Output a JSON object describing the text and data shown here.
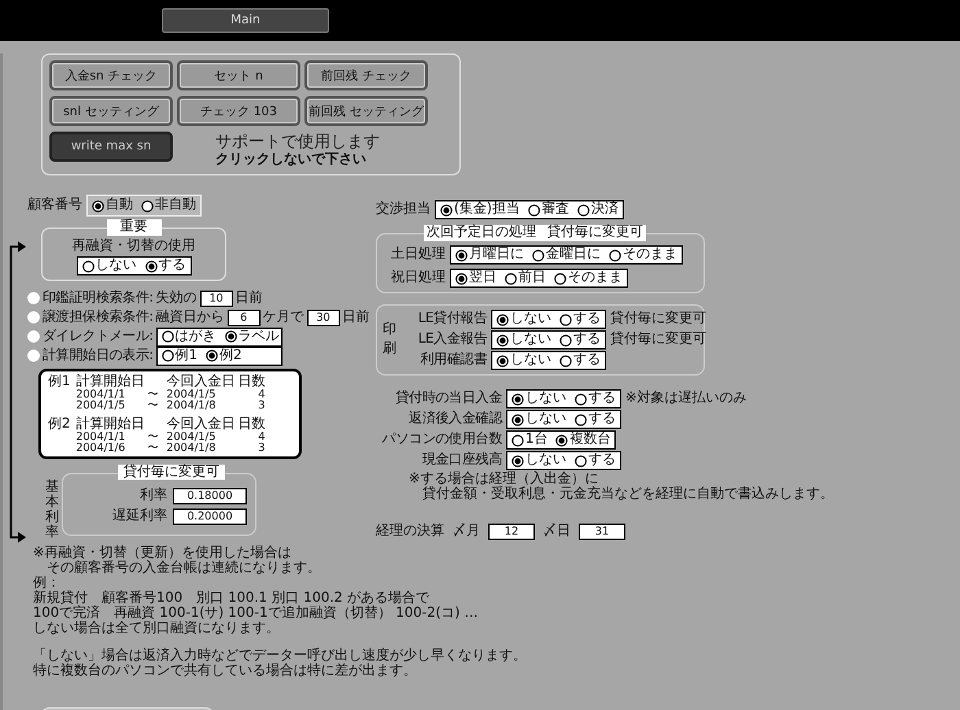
{
  "tab": {
    "label": "Main"
  },
  "tool_buttons": [
    {
      "label": "入金sn チェック",
      "kind": "normal"
    },
    {
      "label": "セット n",
      "kind": "normal"
    },
    {
      "label": "前回残 チェック",
      "kind": "normal"
    },
    {
      "label": "snl セッティング",
      "kind": "normal"
    },
    {
      "label": "チェック 103",
      "kind": "normal"
    },
    {
      "label": "前回残 セッティング",
      "kind": "normal"
    },
    {
      "label": "write max sn",
      "kind": "dark"
    }
  ],
  "support_note": {
    "title": "サポートで使用します",
    "subtitle": "クリックしないで下さい"
  },
  "customer_number": {
    "label": "顧客番号",
    "options": [
      {
        "label": "自動",
        "selected": true
      },
      {
        "label": "非自動",
        "selected": false
      }
    ]
  },
  "important": {
    "heading": "重要",
    "label": "再融資・切替の使用",
    "options": [
      {
        "label": "しない",
        "selected": false
      },
      {
        "label": "する",
        "selected": true
      }
    ]
  },
  "search_settings": [
    {
      "kind": "fields",
      "label": "印鑑証明検索条件:",
      "parts": [
        {
          "kind": "text",
          "text": "失効の"
        },
        {
          "kind": "field",
          "value": "10"
        },
        {
          "kind": "text",
          "text": "日前"
        }
      ]
    },
    {
      "kind": "fields",
      "label": "譲渡担保検索条件:",
      "parts": [
        {
          "kind": "text",
          "text": "融資日から"
        },
        {
          "kind": "field",
          "value": "6"
        },
        {
          "kind": "text",
          "text": "ケ月で"
        },
        {
          "kind": "field",
          "value": "30"
        },
        {
          "kind": "text",
          "text": "日前"
        }
      ]
    },
    {
      "kind": "radio",
      "label": "ダイレクトメール:",
      "options": [
        {
          "label": "はがき",
          "selected": false
        },
        {
          "label": "ラベル",
          "selected": true
        }
      ]
    },
    {
      "kind": "radio",
      "label": "計算開始日の表示:",
      "options": [
        {
          "label": "例1",
          "selected": false
        },
        {
          "label": "例2",
          "selected": true
        }
      ]
    }
  ],
  "examples": [
    {
      "label": "例1",
      "header": [
        "計算開始日",
        "今回入金日",
        "日数"
      ],
      "rows": [
        [
          "2004/1/1",
          "〜",
          "2004/1/5",
          "4"
        ],
        [
          "2004/1/5",
          "〜",
          "2004/1/8",
          "3"
        ]
      ]
    },
    {
      "label": "例2",
      "header": [
        "計算開始日",
        "今回入金日",
        "日数"
      ],
      "rows": [
        [
          "2004/1/1",
          "〜",
          "2004/1/5",
          "4"
        ],
        [
          "2004/1/6",
          "〜",
          "2004/1/8",
          "3"
        ]
      ]
    }
  ],
  "base_rate": {
    "heading": "貸付毎に変更可",
    "side_label": "基本利率",
    "fields": [
      {
        "label": "利率",
        "value": "0.18000"
      },
      {
        "label": "遅延利率",
        "value": "0.20000"
      }
    ]
  },
  "notes": [
    [
      "※再融資・切替（更新）を使用した場合は",
      "　その顧客番号の入金台帳は連続になります。",
      "例：",
      "新規貸付　顧客番号100　別口 100.1 別口 100.2 がある場合で",
      "100で完済　再融資 100-1(サ) 100-1で追加融資（切替） 100-2(コ) …",
      "しない場合は全て別口融資になります。"
    ],
    [
      "「しない」場合は返済入力時などでデーター呼び出し速度が少し早くなります。",
      "特に複数台のパソコンで共有している場合は特に差が出ます。"
    ]
  ],
  "negotiation": {
    "label": "交渉担当",
    "options": [
      {
        "label": "(集金)担当",
        "selected": true
      },
      {
        "label": "審査",
        "selected": false
      },
      {
        "label": "決済",
        "selected": false
      }
    ]
  },
  "next_date": {
    "heading": "次回予定日の処理",
    "heading_note": "貸付毎に変更可",
    "rows": [
      {
        "label": "土日処理",
        "options": [
          {
            "label": "月曜日に",
            "selected": true
          },
          {
            "label": "金曜日に",
            "selected": false
          },
          {
            "label": "そのまま",
            "selected": false
          }
        ]
      },
      {
        "label": "祝日処理",
        "options": [
          {
            "label": "翌日",
            "selected": true
          },
          {
            "label": "前日",
            "selected": false
          },
          {
            "label": "そのまま",
            "selected": false
          }
        ]
      }
    ]
  },
  "print": {
    "side_label": "印刷",
    "rows": [
      {
        "label": "LE貸付報告",
        "options": [
          {
            "label": "しない",
            "selected": true
          },
          {
            "label": "する",
            "selected": false
          }
        ],
        "note": "貸付毎に変更可"
      },
      {
        "label": "LE入金報告",
        "options": [
          {
            "label": "しない",
            "selected": true
          },
          {
            "label": "する",
            "selected": false
          }
        ],
        "note": "貸付毎に変更可"
      },
      {
        "label": "利用確認書",
        "options": [
          {
            "label": "しない",
            "selected": true
          },
          {
            "label": "する",
            "selected": false
          }
        ]
      }
    ]
  },
  "loan_settings": {
    "rows": [
      {
        "label": "貸付時の当日入金",
        "options": [
          {
            "label": "しない",
            "selected": true
          },
          {
            "label": "する",
            "selected": false
          }
        ],
        "note": "※対象は遅払いのみ"
      },
      {
        "label": "返済後入金確認",
        "options": [
          {
            "label": "しない",
            "selected": true
          },
          {
            "label": "する",
            "selected": false
          }
        ]
      },
      {
        "label": "パソコンの使用台数",
        "options": [
          {
            "label": "1台",
            "selected": false
          },
          {
            "label": "複数台",
            "selected": true
          }
        ]
      },
      {
        "label": "現金口座残高",
        "options": [
          {
            "label": "しない",
            "selected": true
          },
          {
            "label": "する",
            "selected": false
          }
        ]
      }
    ],
    "note_lines": [
      "※する場合は経理（入出金）に",
      "　貸付金額・受取利息・元金充当などを経理に自動で書込みします。"
    ]
  },
  "closing": {
    "label": "経理の決算",
    "month_label": "〆月",
    "month": "12",
    "day_label": "〆日",
    "day": "31"
  }
}
